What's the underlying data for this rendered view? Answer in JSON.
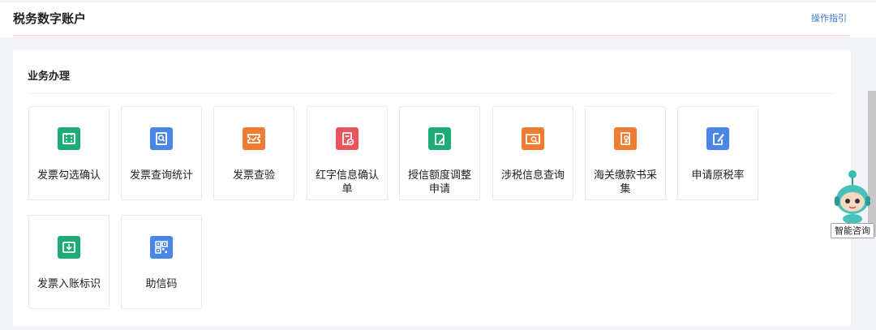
{
  "header": {
    "title": "税务数字账户",
    "guide_link": "操作指引"
  },
  "section": {
    "title": "业务办理"
  },
  "tiles": [
    {
      "label": "发票勾选确认",
      "icon": "ticket-icon",
      "color": "#1dab78"
    },
    {
      "label": "发票查询统计",
      "icon": "invoice-search-icon",
      "color": "#4a86e8"
    },
    {
      "label": "发票查验",
      "icon": "coupon-check-icon",
      "color": "#f07c32"
    },
    {
      "label": "红字信息确认单",
      "icon": "invoice-confirm-icon",
      "color": "#e9555d"
    },
    {
      "label": "授信额度调整申请",
      "icon": "edit-document-icon",
      "color": "#1dab78"
    },
    {
      "label": "涉税信息查询",
      "icon": "folder-search-icon",
      "color": "#f07c32"
    },
    {
      "label": "海关缴款书采集",
      "icon": "customs-document-icon",
      "color": "#f07c32"
    },
    {
      "label": "申请原税率",
      "icon": "pencil-note-icon",
      "color": "#4a86e8"
    },
    {
      "label": "发票入账标识",
      "icon": "inbox-download-icon",
      "color": "#1dab78"
    },
    {
      "label": "助信码",
      "icon": "qr-code-icon",
      "color": "#4a86e8"
    }
  ],
  "assistant": {
    "label": "智能咨询",
    "icon": "robot-assistant-icon"
  }
}
